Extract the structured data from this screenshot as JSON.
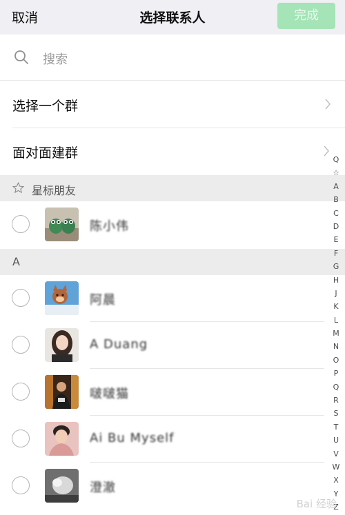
{
  "nav": {
    "cancel": "取消",
    "title": "选择联系人",
    "done": "完成"
  },
  "search": {
    "placeholder": "搜索"
  },
  "rows": [
    {
      "label": "选择一个群"
    },
    {
      "label": "面对面建群"
    }
  ],
  "sections": {
    "starred": "星标朋友",
    "a": "A"
  },
  "contacts": [
    {
      "name": "陈小伟",
      "avatar_icon": "green-frogs-avatar"
    },
    {
      "name": "阿晨",
      "avatar_icon": "cartoon-cat-avatar"
    },
    {
      "name": "A Duang",
      "avatar_icon": "woman-portrait-avatar"
    },
    {
      "name": "啵啵猫",
      "avatar_icon": "man-portrait-avatar"
    },
    {
      "name": "Ai Bu Myself",
      "avatar_icon": "young-man-avatar"
    },
    {
      "name": "澄澈",
      "avatar_icon": "pet-photo-avatar"
    }
  ],
  "index": [
    "Q",
    "☆",
    "A",
    "B",
    "C",
    "D",
    "E",
    "F",
    "G",
    "H",
    "J",
    "K",
    "L",
    "M",
    "N",
    "O",
    "P",
    "Q",
    "R",
    "S",
    "T",
    "U",
    "V",
    "W",
    "X",
    "Y",
    "Z"
  ],
  "watermark": "Bai 经验",
  "colors": {
    "done_bg": "#a4e4b6",
    "nav_bg": "#efeff4",
    "section_bg": "#ececec"
  }
}
